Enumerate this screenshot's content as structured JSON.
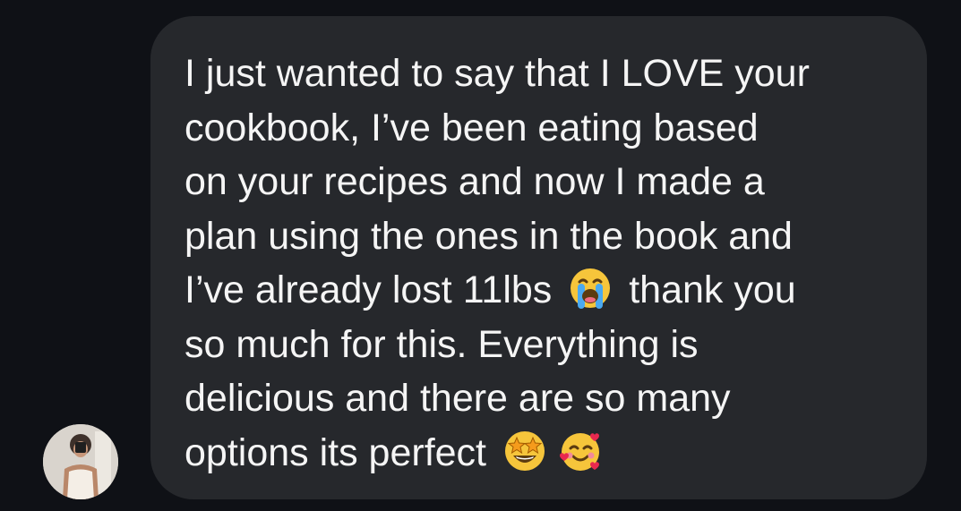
{
  "conversation": {
    "message": {
      "lines": [
        [
          {
            "text": "I just wanted to say that I LOVE your"
          }
        ],
        [
          {
            "text": "cookbook, I’ve been eating based"
          }
        ],
        [
          {
            "text": "on your recipes and now I made a"
          }
        ],
        [
          {
            "text": "plan using the ones in the book and"
          }
        ],
        [
          {
            "text": "I’ve already lost 11lbs "
          },
          {
            "emoji": "loudly-crying-face"
          },
          {
            "text": " thank you"
          }
        ],
        [
          {
            "text": "so much for this. Everything is"
          }
        ],
        [
          {
            "text": "delicious and there are so many"
          }
        ],
        [
          {
            "text": "options its perfect "
          },
          {
            "emoji": "star-struck-face"
          },
          {
            "emoji": "smiling-face-with-hearts"
          }
        ]
      ]
    }
  },
  "colors": {
    "background": "#0f1116",
    "bubble": "#26282c",
    "text": "#f5f5f5",
    "emoji_yellow": "#f6c53b"
  }
}
